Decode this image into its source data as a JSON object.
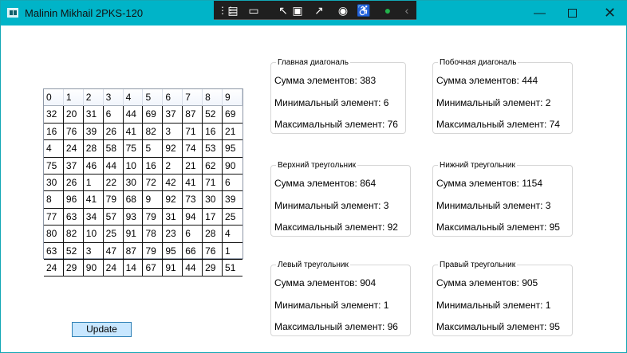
{
  "window": {
    "title": "Malinin Mikhail 2PKS-120",
    "controls": {
      "minimize": "—",
      "close": "✕"
    }
  },
  "debug_toolbar": {
    "icons": [
      "drag-handle-icon",
      "live-visual-tree-icon",
      "video-camera-icon",
      "select-element-icon",
      "display-layout-adorners-icon",
      "track-focus-icon",
      "hot-reload-icon",
      "accessibility-icon",
      "checkmark-icon",
      "collapse-toolbar-icon"
    ],
    "check_color": "#21b24b"
  },
  "grid": {
    "headers": [
      "0",
      "1",
      "2",
      "3",
      "4",
      "5",
      "6",
      "7",
      "8",
      "9"
    ],
    "rows": [
      [
        "32",
        "20",
        "31",
        "6",
        "44",
        "69",
        "37",
        "87",
        "52",
        "69"
      ],
      [
        "16",
        "76",
        "39",
        "26",
        "41",
        "82",
        "3",
        "71",
        "16",
        "21"
      ],
      [
        "4",
        "24",
        "28",
        "58",
        "75",
        "5",
        "92",
        "74",
        "53",
        "95"
      ],
      [
        "75",
        "37",
        "46",
        "44",
        "10",
        "16",
        "2",
        "21",
        "62",
        "90"
      ],
      [
        "30",
        "26",
        "1",
        "22",
        "30",
        "72",
        "42",
        "41",
        "71",
        "6"
      ],
      [
        "8",
        "96",
        "41",
        "79",
        "68",
        "9",
        "92",
        "73",
        "30",
        "39"
      ],
      [
        "77",
        "63",
        "34",
        "57",
        "93",
        "79",
        "31",
        "94",
        "17",
        "25"
      ],
      [
        "80",
        "82",
        "10",
        "25",
        "91",
        "78",
        "23",
        "6",
        "28",
        "4"
      ],
      [
        "63",
        "52",
        "3",
        "47",
        "87",
        "79",
        "95",
        "66",
        "76",
        "1"
      ],
      [
        "24",
        "29",
        "90",
        "24",
        "14",
        "67",
        "91",
        "44",
        "29",
        "51"
      ]
    ]
  },
  "groups": [
    {
      "title": "Главная диагональ",
      "sum": "Сумма элементов: 383",
      "min": "Минимальный элемент: 6",
      "max": "Максимальный элемент: 76"
    },
    {
      "title": "Побочная диагональ",
      "sum": "Сумма элементов: 444",
      "min": "Минимальный элемент: 2",
      "max": "Максимальный элемент: 74"
    },
    {
      "title": "Верхний треугольник",
      "sum": "Сумма элементов: 864",
      "min": "Минимальный элемент: 3",
      "max": "Максимальный элемент: 92"
    },
    {
      "title": "Нижний треугольник",
      "sum": "Сумма элементов: 1154",
      "min": "Минимальный элемент: 3",
      "max": "Максимальный элемент: 95"
    },
    {
      "title": "Левый треугольник",
      "sum": "Сумма элементов: 904",
      "min": "Минимальный элемент: 1",
      "max": "Максимальный элемент: 96"
    },
    {
      "title": "Правый треугольник",
      "sum": "Сумма элементов: 905",
      "min": "Минимальный элемент: 1",
      "max": "Максимальный элемент: 95"
    }
  ],
  "buttons": {
    "update": "Update"
  },
  "colors": {
    "titlebar": "#00b4c8",
    "button_background": "#c8e7ff",
    "button_border": "#2d7fb5"
  }
}
